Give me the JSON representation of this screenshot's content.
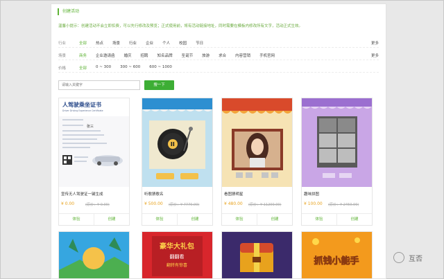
{
  "panel": {
    "title": "创建活动",
    "hint": "温馨小提示：创建活动不会立即扣费，可以先行修改及预览；正式使用前，将有活动链接地址，同时需要在模板内修改所有文字，活动正式生效。"
  },
  "filters": [
    {
      "label": "行业",
      "options": [
        "全部",
        "热点",
        "场景",
        "行业",
        "企业",
        "个人",
        "校园",
        "节日"
      ],
      "active": 0,
      "more": "更多"
    },
    {
      "label": "场景",
      "options": [
        "商务",
        "企业邀请函",
        "婚庆",
        "招聘",
        "知名品牌",
        "圣诞节",
        "旅游",
        "求合",
        "内容营销",
        "手机官网"
      ],
      "active": 0,
      "more": "更多"
    },
    {
      "label": "价格",
      "options": [
        "全部",
        "0 ~ 300",
        "300 ~ 600",
        "600 ~ 1000"
      ],
      "active": 0,
      "more": ""
    }
  ],
  "search": {
    "placeholder": "请输入关键字",
    "button": "搜一下"
  },
  "cards": [
    {
      "name": "宣传无人驾驶证一键生成",
      "price": "¥ 0.00",
      "orig": "(原价：¥ 0.00)",
      "action1": "体验",
      "action2": "创建",
      "thumb": "license",
      "thumb_title": "人驾驶乘坐证书",
      "thumb_subtitle": "Driver Driving Experience Certificate",
      "thumb_name": "张三"
    },
    {
      "name": "听歌猜歌名",
      "price": "¥ 500.00",
      "orig": "(原价：¥ 7770.00)",
      "action1": "体验",
      "action2": "创建",
      "thumb": "record"
    },
    {
      "name": "看图猜明星",
      "price": "¥ 480.00",
      "orig": "(原价：¥ 11200.00)",
      "action1": "体验",
      "action2": "创建",
      "thumb": "photo"
    },
    {
      "name": "趣味拼图",
      "price": "¥ 100.00",
      "orig": "(原价：¥ 2450.00)",
      "action1": "体验",
      "action2": "创建",
      "thumb": "puzzle"
    }
  ],
  "cards_row2": [
    {
      "thumb": "tropical"
    },
    {
      "thumb": "giftpack",
      "text1": "豪华大礼包",
      "text2": "翻翻看",
      "text3": "翻转有惊喜"
    },
    {
      "thumb": "chest"
    },
    {
      "thumb": "coins",
      "text1": "抓钱小能手"
    }
  ],
  "watermark": {
    "text": "互否"
  },
  "colors": {
    "brand_green": "#3dae35",
    "price_orange": "#e8a21d"
  }
}
